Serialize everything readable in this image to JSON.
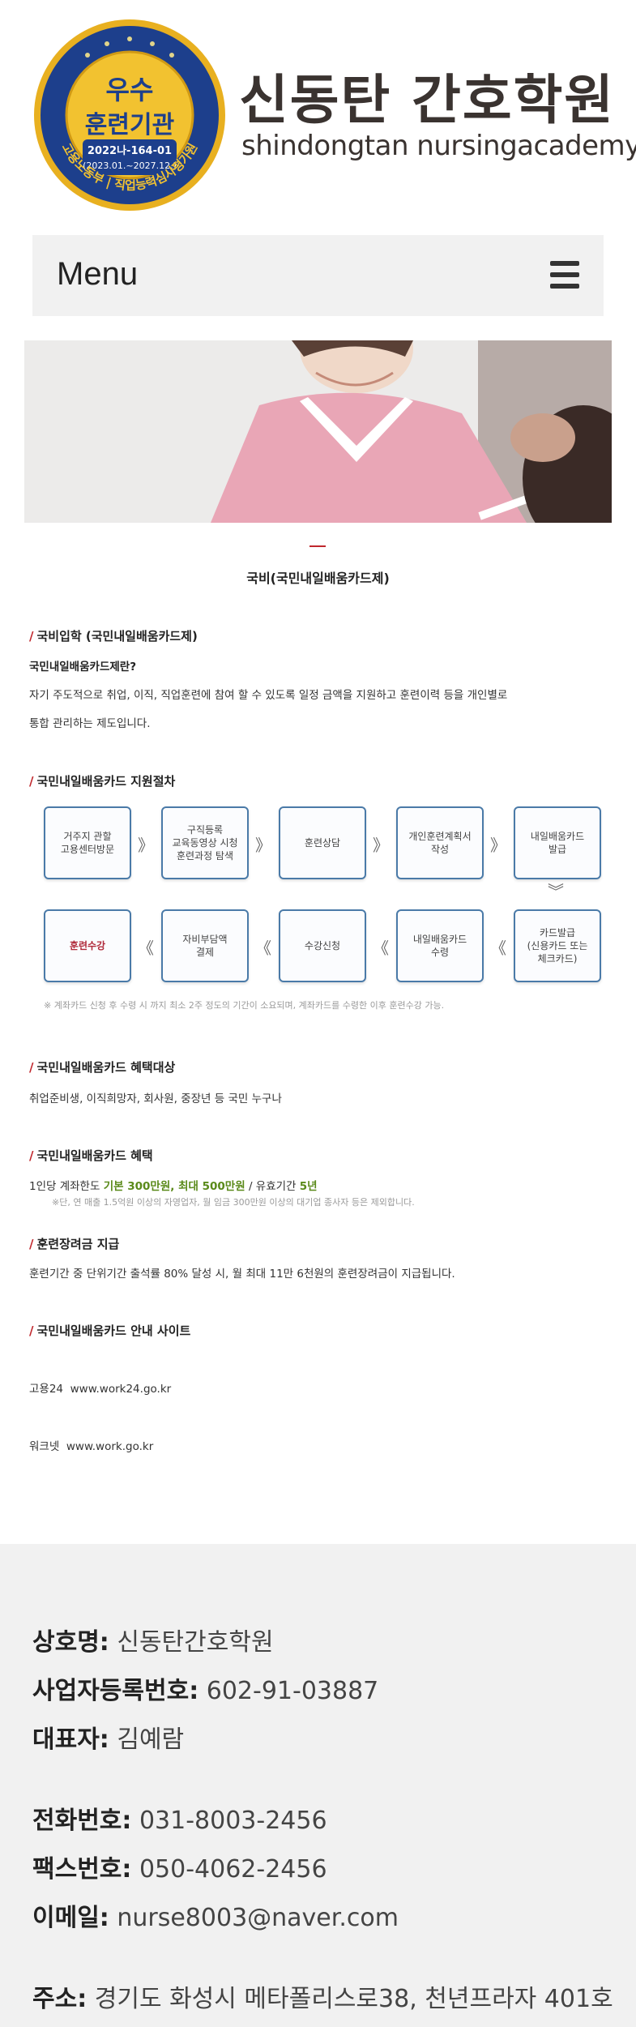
{
  "header": {
    "seal": {
      "top_text": "우수",
      "main_text": "훈련기관",
      "code": "2022나-164-01",
      "period": "(2023.01.~2027.12.)",
      "ring_text": "고용노동부 | 직업능력심사평가원"
    },
    "brand_kr": "신동탄 간호학원",
    "brand_en": "shindongtan nursingacademy"
  },
  "menu": {
    "label": "Menu"
  },
  "page_title": "국비(국민내일배움카드제)",
  "sections": {
    "entry": {
      "heading": "국비입학 (국민내일배움카드제)",
      "subheading": "국민내일배움카드제란?",
      "line1": "자기 주도적으로 취업, 이직, 직업훈련에 참여 할 수 있도록 일정 금액을 지원하고 훈련이력 등을 개인별로",
      "line2": "통합 관리하는 제도입니다."
    },
    "procedure": {
      "heading": "국민내일배움카드 지원절차",
      "row1": [
        "거주지 관할\n고용센터방문",
        "구직등록\n교육동영상 시청\n훈련과정 탐색",
        "훈련상담",
        "개인훈련계획서\n작성",
        "내일배움카드\n발급"
      ],
      "row2": [
        "훈련수강",
        "자비부담액\n결제",
        "수강신청",
        "내일배움카드\n수령",
        "카드발급\n(신용카드 또는\n체크카드)"
      ],
      "arrow_right": "》",
      "arrow_left": "《",
      "arrow_down": "︾",
      "note": "※ 계좌카드 신청 후 수령 시 까지 최소 2주 정도의 기간이 소요되며, 계좌카드를 수령한 이후 훈련수강 가능."
    },
    "target": {
      "heading": "국민내일배움카드 혜택대상",
      "text": "취업준비생, 이직희망자, 회사원, 중장년 등 국민 누구나"
    },
    "benefit": {
      "heading": "국민내일배움카드 혜택",
      "prefix": "1인당 계좌한도 ",
      "amount": "기본 300만원, 최대 500만원",
      "middle": " / 유효기간 ",
      "period": "5년",
      "note": "※단, 연 매출 1.5억원 이상의 자영업자, 월 임금 300만원 이상의 대기업 종사자 등은 제외합니다."
    },
    "incentive": {
      "heading": "훈련장려금 지급",
      "text": "훈련기간 중 단위기간 출석률 80% 달성 시, 월 최대 11만 6천원의 훈련장려금이 지급됩니다."
    },
    "sites": {
      "heading": "국민내일배움카드 안내 사이트",
      "items": [
        {
          "name": "고용24",
          "url": "www.work24.go.kr"
        },
        {
          "name": "워크넷",
          "url": "www.work.go.kr"
        }
      ]
    }
  },
  "footer": {
    "company_label": "상호명:",
    "company": "신동탄간호학원",
    "bizno_label": "사업자등록번호:",
    "bizno": "602-91-03887",
    "ceo_label": "대표자:",
    "ceo": "김예람",
    "tel_label": "전화번호:",
    "tel": "031-8003-2456",
    "fax_label": "팩스번호:",
    "fax": "050-4062-2456",
    "email_label": "이메일:",
    "email": "nurse8003@naver.com",
    "addr_label": "주소:",
    "addr": "경기도 화성시 메타폴리스로38, 천년프라자 401호"
  },
  "colors": {
    "accent_red": "#c0272d",
    "seal_navy": "#1d3f8c",
    "seal_gold": "#e8b020",
    "box_border": "#4a7aa8",
    "benefit_green": "#5a8a1a"
  }
}
